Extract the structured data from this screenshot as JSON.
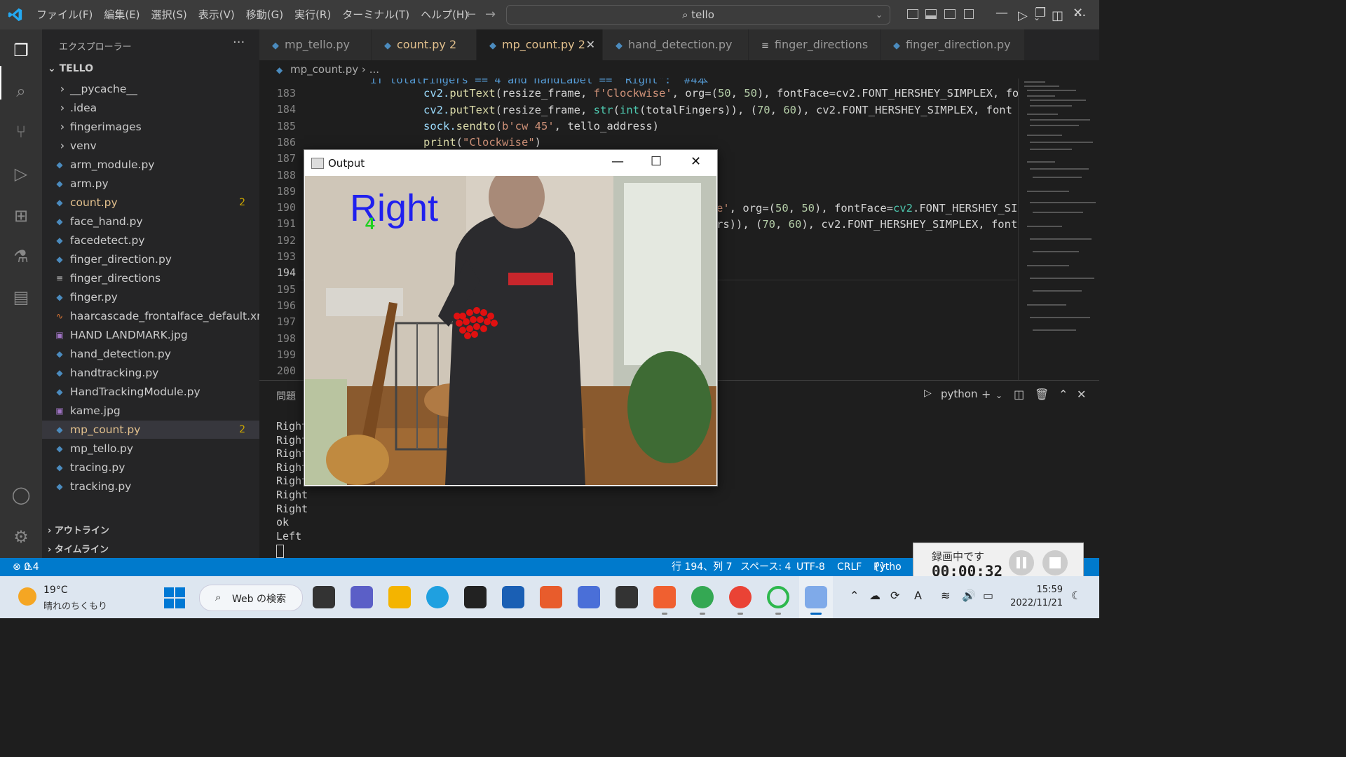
{
  "titlebar": {
    "menu": [
      "ファイル(F)",
      "編集(E)",
      "選択(S)",
      "表示(V)",
      "移動(G)",
      "実行(R)",
      "ターミナル(T)",
      "ヘルプ(H)"
    ],
    "search_text": "tello"
  },
  "sidebar": {
    "title": "エクスプローラー",
    "root": "TELLO",
    "folders": [
      "__pycache__",
      ".idea",
      "fingerimages",
      "venv"
    ],
    "files": [
      {
        "name": "arm_module.py",
        "icon": "python-icon"
      },
      {
        "name": "arm.py",
        "icon": "python-icon"
      },
      {
        "name": "count.py",
        "icon": "python-icon",
        "badge": "2"
      },
      {
        "name": "face_hand.py",
        "icon": "python-icon"
      },
      {
        "name": "facedetect.py",
        "icon": "python-icon"
      },
      {
        "name": "finger_direction.py",
        "icon": "python-icon"
      },
      {
        "name": "finger_directions",
        "icon": "text-file-icon"
      },
      {
        "name": "finger.py",
        "icon": "python-icon"
      },
      {
        "name": "haarcascade_frontalface_default.xml",
        "icon": "rss-icon"
      },
      {
        "name": "HAND LANDMARK.jpg",
        "icon": "image-icon"
      },
      {
        "name": "hand_detection.py",
        "icon": "python-icon"
      },
      {
        "name": "handtracking.py",
        "icon": "python-icon"
      },
      {
        "name": "HandTrackingModule.py",
        "icon": "python-icon"
      },
      {
        "name": "kame.jpg",
        "icon": "image-icon"
      },
      {
        "name": "mp_count.py",
        "icon": "python-icon",
        "badge": "2"
      },
      {
        "name": "mp_tello.py",
        "icon": "python-icon"
      },
      {
        "name": "tracing.py",
        "icon": "python-icon"
      },
      {
        "name": "tracking.py",
        "icon": "python-icon"
      }
    ],
    "outline_label": "アウトライン",
    "timeline_label": "タイムライン"
  },
  "tabs": [
    {
      "label": "mp_tello.py",
      "badge": ""
    },
    {
      "label": "count.py",
      "badge": "2"
    },
    {
      "label": "mp_count.py",
      "badge": "2"
    },
    {
      "label": "hand_detection.py",
      "badge": ""
    },
    {
      "label": "finger_directions",
      "badge": ""
    },
    {
      "label": "finger_direction.py",
      "badge": ""
    }
  ],
  "breadcrumb": {
    "file": "mp_count.py",
    "rest": "..."
  },
  "editor": {
    "line_numbers": [
      "183",
      "184",
      "185",
      "186",
      "187",
      "188",
      "189",
      "190",
      "191",
      "192",
      "193",
      "194",
      "195",
      "196",
      "197",
      "198",
      "199",
      "200"
    ],
    "top_partial": "if totalFingers == 4 and handLabel == \"Right\":  #4本",
    "line183": [
      "cv2.",
      "putText",
      "(resize_frame, ",
      "f'Clockwise'",
      ", org=(",
      "50",
      ", ",
      "50",
      "), fontFace=cv2.FONT_HERSHEY_SIMPLEX, fo"
    ],
    "line184": [
      "cv2.",
      "putText",
      "(resize_frame, ",
      "str",
      "(",
      "int",
      "(totalFingers)), (",
      "70",
      ", ",
      "60",
      "), cv2.FONT_HERSHEY_SIMPLEX, font"
    ],
    "line185": [
      "sock.",
      "sendto",
      "(",
      "b'cw 45'",
      ", tello_address)"
    ],
    "line186": [
      "print",
      "(",
      "\"Clockwise\"",
      ")"
    ],
    "line190_tail": [
      "e'",
      ", org=(",
      "50",
      ", ",
      "50",
      "), fontFace=",
      "cv2",
      ".FONT_HERSHEY_SI"
    ],
    "line191_tail": [
      "rs)), (",
      "70",
      ", ",
      "60",
      "), cv2.FONT_HERSHEY_SIMPLEX, font"
    ]
  },
  "panel": {
    "tab_label": "問題",
    "terminal_name": "python",
    "terminal_lines": [
      "Right",
      "Right",
      "Right",
      "Right",
      "Right",
      "Right",
      "Right",
      "ok",
      "Left"
    ]
  },
  "output_window": {
    "title": "Output",
    "overlay_label": "Right",
    "overlay_count": "4"
  },
  "statusbar": {
    "errors": "0",
    "warnings": "4",
    "position": "行 194、列 7",
    "spaces": "スペース: 4",
    "encoding": "UTF-8",
    "eol": "CRLF",
    "language": "Pytho"
  },
  "recording": {
    "label": "録画中です",
    "time": "00:00:32"
  },
  "taskbar": {
    "weather_temp": "19°C",
    "weather_desc": "晴れのちくもり",
    "search_label": "Web の検索",
    "time": "15:59",
    "date": "2022/11/21"
  }
}
